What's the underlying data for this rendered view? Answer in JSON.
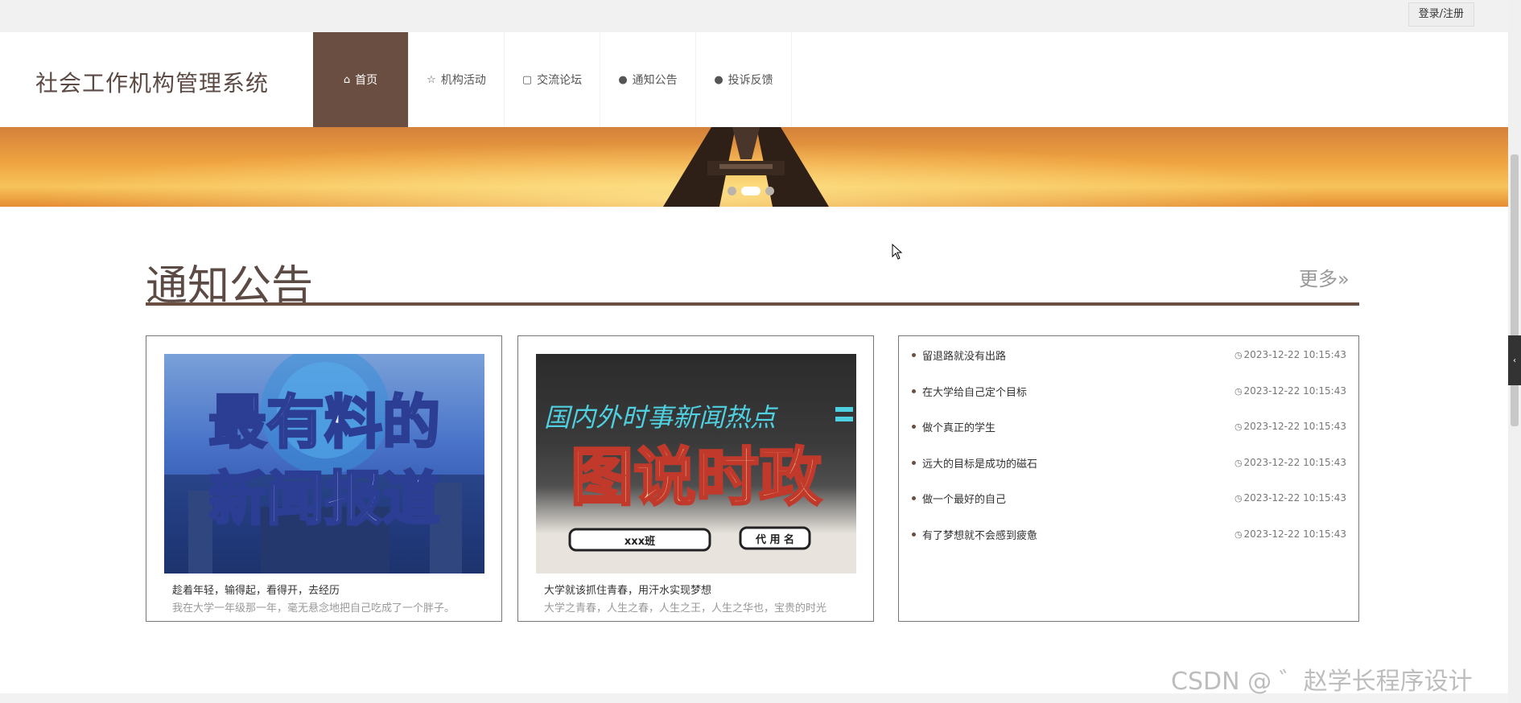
{
  "topbar": {
    "login_label": "登录/注册"
  },
  "header": {
    "site_title": "社会工作机构管理系统",
    "nav": [
      {
        "label": "首页",
        "icon": "home-icon",
        "active": true
      },
      {
        "label": "机构活动",
        "icon": "star-icon",
        "active": false
      },
      {
        "label": "交流论坛",
        "icon": "bag-icon",
        "active": false
      },
      {
        "label": "通知公告",
        "icon": "alert-icon",
        "active": false
      },
      {
        "label": "投诉反馈",
        "icon": "question-icon",
        "active": false
      }
    ]
  },
  "banner": {
    "slides": 3,
    "active_slide": 2
  },
  "notice": {
    "section_title": "通知公告",
    "more_label": "更多»",
    "cards": [
      {
        "title": "趁着年轻，输得起，看得开，去经历",
        "desc": "我在大学一年级那一年，毫无悬念地把自己吃成了一个胖子。",
        "image_text_1": "最有料的",
        "image_text_2": "新闻报道"
      },
      {
        "title": "大学就该抓住青春，用汗水实现梦想",
        "desc": "大学之青春，人生之春，人生之王，人生之华也，宝贵的时光",
        "image_text_1": "国内外时事新闻热点",
        "image_text_2": "图说时政",
        "image_label_1": "xxx班",
        "image_label_2": "代 用 名"
      }
    ],
    "list": [
      {
        "title": "留退路就没有出路",
        "date": "2023-12-22 10:15:43"
      },
      {
        "title": "在大学给自己定个目标",
        "date": "2023-12-22 10:15:43"
      },
      {
        "title": "做个真正的学生",
        "date": "2023-12-22 10:15:43"
      },
      {
        "title": "远大的目标是成功的磁石",
        "date": "2023-12-22 10:15:43"
      },
      {
        "title": "做一个最好的自己",
        "date": "2023-12-22 10:15:43"
      },
      {
        "title": "有了梦想就不会感到疲惫",
        "date": "2023-12-22 10:15:43"
      }
    ]
  },
  "watermark": "CSDN @ ゛赵学长程序设计",
  "colors": {
    "brand": "#6b4e42",
    "title": "#5c4a44"
  }
}
